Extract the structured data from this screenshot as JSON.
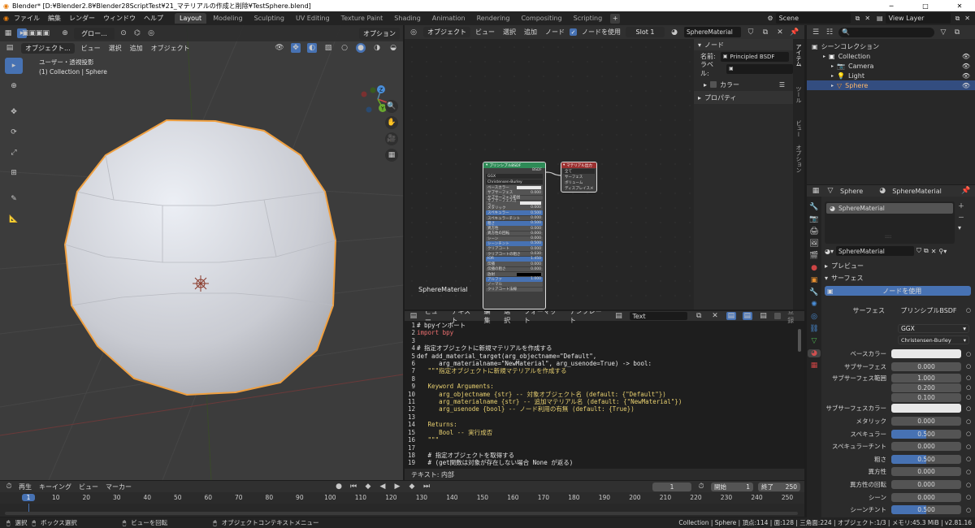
{
  "window": {
    "title": "Blender* [D:¥Blender2.8¥Blender28ScriptTest¥21_マテリアルの作成と削除¥TestSphere.blend]",
    "btn_min": "─",
    "btn_max": "□",
    "btn_close": "✕"
  },
  "topbar": {
    "menus": [
      "ファイル",
      "編集",
      "レンダー",
      "ウィンドウ",
      "ヘルプ"
    ],
    "workspaces": [
      "Layout",
      "Modeling",
      "Sculpting",
      "UV Editing",
      "Texture Paint",
      "Shading",
      "Animation",
      "Rendering",
      "Compositing",
      "Scripting"
    ],
    "active_workspace": "Layout",
    "add_workspace": "+",
    "scene": "Scene",
    "view_layer": "View Layer"
  },
  "viewport": {
    "mode": "オブジェクト...",
    "menus": [
      "ビュー",
      "選択",
      "追加",
      "オブジェクト"
    ],
    "orient": "グロー...",
    "options": "オプション",
    "info_line1": "ユーザー・透視投影",
    "info_line2": "(1) Collection | Sphere",
    "gizmo_x": "X",
    "gizmo_y": "Y",
    "gizmo_z": "Z"
  },
  "node_editor": {
    "mode": "オブジェクト",
    "menus": [
      "ビュー",
      "選択",
      "追加",
      "ノード"
    ],
    "use_nodes_label": "ノードを使用",
    "slot": "Slot 1",
    "material": "SphereMaterial",
    "material_label": "SphereMaterial",
    "tabs": [
      "アイテム",
      "ツール",
      "ビュー",
      "オプション"
    ],
    "npanel": {
      "section": "ノード",
      "name_label": "名前:",
      "name_value": "Principled BSDF",
      "label_label": "ラベル:",
      "color_label": "カラー",
      "properties_label": "プロパティ"
    },
    "bsdf_node": {
      "title": "プリンシプルBSDF",
      "output": "BSDF",
      "dist": "GGX",
      "sss": "Christensen-Burley",
      "rows": [
        {
          "label": "ベースカラー",
          "value": ""
        },
        {
          "label": "サブサーフェス",
          "value": "0.000"
        },
        {
          "label": "サブサーフェス範囲",
          "value": ""
        },
        {
          "label": "サブサーフェスカラー",
          "value": ""
        },
        {
          "label": "メタリック",
          "value": "0.000"
        },
        {
          "label": "スペキュラー",
          "value": "0.500"
        },
        {
          "label": "スペキュラーチント",
          "value": "0.000"
        },
        {
          "label": "粗さ",
          "value": "0.500"
        },
        {
          "label": "異方性",
          "value": "0.000"
        },
        {
          "label": "異方性の回転",
          "value": "0.000"
        },
        {
          "label": "シーン",
          "value": "0.000"
        },
        {
          "label": "シーンチント",
          "value": "0.500"
        },
        {
          "label": "クリアコート",
          "value": "0.000"
        },
        {
          "label": "クリアコートの粗さ",
          "value": "0.030"
        },
        {
          "label": "IOR",
          "value": "1.450"
        },
        {
          "label": "伝播",
          "value": "0.000"
        },
        {
          "label": "伝播の粗さ",
          "value": "0.000"
        },
        {
          "label": "放射",
          "value": ""
        },
        {
          "label": "アルファ",
          "value": "1.000"
        },
        {
          "label": "ノーマル",
          "value": ""
        },
        {
          "label": "クリアコート法線",
          "value": ""
        }
      ]
    },
    "output_node": {
      "title": "マテリアル出力",
      "target": "全て",
      "sockets": [
        "サーフェス",
        "ボリューム",
        "ディスプレイスメント"
      ]
    }
  },
  "text_editor": {
    "menus": [
      "ビュー",
      "テキスト",
      "編集",
      "選択",
      "フォーマット",
      "テンプレート"
    ],
    "file": "Text",
    "register": "登録",
    "status": "テキスト: 内部",
    "lines": [
      {
        "n": "1",
        "t": "# bpyインポート"
      },
      {
        "n": "2",
        "t": "import bpy"
      },
      {
        "n": "3",
        "t": ""
      },
      {
        "n": "4",
        "t": "# 指定オブジェクトに新規マテリアルを作成する"
      },
      {
        "n": "5",
        "t": "def add_material_target(arg_objectname=\"Default\","
      },
      {
        "n": "6",
        "t": "      arg_materialname=\"NewMaterial\", arg_usenode=True) -> bool:"
      },
      {
        "n": "7",
        "t": "   \"\"\"指定オブジェクトに新規マテリアルを作成する"
      },
      {
        "n": "8",
        "t": ""
      },
      {
        "n": "9",
        "t": "   Keyword Arguments:"
      },
      {
        "n": "10",
        "t": "      arg_objectname {str} -- 対象オブジェクト名 (default: {\"Default\"})"
      },
      {
        "n": "11",
        "t": "      arg_materialname {str} -- 追加マテリアル名 (default: {\"NewMaterial\"})"
      },
      {
        "n": "12",
        "t": "      arg_usenode {bool} -- ノード利用の有無 (default: {True})"
      },
      {
        "n": "13",
        "t": ""
      },
      {
        "n": "14",
        "t": "   Returns:"
      },
      {
        "n": "15",
        "t": "      Bool -- 実行成否"
      },
      {
        "n": "16",
        "t": "   \"\"\""
      },
      {
        "n": "17",
        "t": ""
      },
      {
        "n": "18",
        "t": "   # 指定オブジェクトを取得する"
      },
      {
        "n": "19",
        "t": "   # (get関数は対象が存在しない場合 None が返る)"
      }
    ]
  },
  "outliner": {
    "title": "シーンコレクション",
    "items": [
      {
        "name": "Collection",
        "indent": 1
      },
      {
        "name": "Camera",
        "indent": 2
      },
      {
        "name": "Light",
        "indent": 2
      },
      {
        "name": "Sphere",
        "indent": 2,
        "selected": true
      }
    ]
  },
  "properties": {
    "object": "Sphere",
    "material": "SphereMaterial",
    "slot_name": "SphereMaterial",
    "slot_dots": "::::",
    "mat_field": "SphereMaterial",
    "preview_label": "プレビュー",
    "surface_section": "サーフェス",
    "use_nodes_btn": "ノードを使用",
    "surface_label": "サーフェス",
    "surface_value": "プリンシプルBSDF",
    "dist": "GGX",
    "sss": "Christensen-Burley",
    "rows": [
      {
        "label": "ベースカラー",
        "value": "",
        "type": "color"
      },
      {
        "label": "サブサーフェス",
        "value": "0.000",
        "type": "num"
      },
      {
        "label": "サブサーフェス範囲",
        "value": "1.000",
        "type": "num"
      },
      {
        "label": "",
        "value": "0.200",
        "type": "num"
      },
      {
        "label": "",
        "value": "0.100",
        "type": "num"
      },
      {
        "label": "サブサーフェスカラー",
        "value": "",
        "type": "color"
      },
      {
        "label": "メタリック",
        "value": "0.000",
        "type": "num"
      },
      {
        "label": "スペキュラー",
        "value": "0.500",
        "type": "slider"
      },
      {
        "label": "スペキュラーチント",
        "value": "0.000",
        "type": "num"
      },
      {
        "label": "粗さ",
        "value": "0.500",
        "type": "slider"
      },
      {
        "label": "異方性",
        "value": "0.000",
        "type": "num"
      },
      {
        "label": "異方性の回転",
        "value": "0.000",
        "type": "num"
      },
      {
        "label": "シーン",
        "value": "0.000",
        "type": "num"
      },
      {
        "label": "シーンチント",
        "value": "0.500",
        "type": "slider"
      }
    ]
  },
  "timeline": {
    "menus": [
      "再生",
      "キーイング",
      "ビュー",
      "マーカー"
    ],
    "ticks": [
      "1",
      "10",
      "20",
      "30",
      "40",
      "50",
      "60",
      "70",
      "80",
      "90",
      "100",
      "110",
      "120",
      "130",
      "140",
      "150",
      "160",
      "170",
      "180",
      "190",
      "200",
      "210",
      "220",
      "230",
      "240",
      "250"
    ],
    "current": "1",
    "start_label": "開始",
    "start": "1",
    "end_label": "終了",
    "end": "250"
  },
  "statusbar": {
    "select": "選択",
    "box": "ボックス選択",
    "rotate": "ビューを回転",
    "context": "オブジェクトコンテキストメニュー",
    "info": "Collection | Sphere | 頂点:114 | 面:128 | 三角面:224 | オブジェクト:1/3 | メモリ:45.3 MiB | v2.81.16"
  }
}
